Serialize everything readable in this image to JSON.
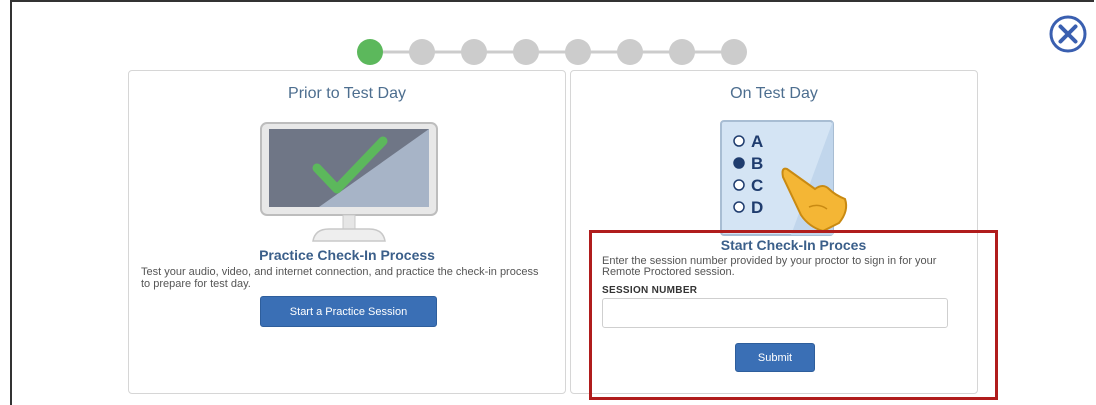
{
  "progress": {
    "total_steps": 8,
    "current_step": 1,
    "active_color": "#5cb85c",
    "inactive_color": "#cccccc"
  },
  "close": {
    "icon": "close-circle-icon",
    "color": "#3a5fb0"
  },
  "prior": {
    "title": "Prior to Test Day",
    "icon": "monitor-checkmark-icon",
    "heading": "Practice Check-In Process",
    "description": "Test your audio, video, and internet connection, and practice the check-in process to prepare for test day.",
    "button_label": "Start a Practice Session"
  },
  "on_day": {
    "title": "On Test Day",
    "icon": "answer-sheet-hand-icon",
    "choices": [
      "A",
      "B",
      "C",
      "D"
    ],
    "selected_choice": "B",
    "heading": "Start Check-In Proces",
    "description": "Enter the session number provided by your proctor to sign in for your Remote Proctored session.",
    "session_label": "SESSION NUMBER",
    "session_value": "",
    "submit_label": "Submit"
  },
  "colors": {
    "primary_button": "#3a6fb5",
    "heading": "#3b5f8a",
    "highlight": "#b01c1c",
    "checkmark": "#5cb85c"
  }
}
